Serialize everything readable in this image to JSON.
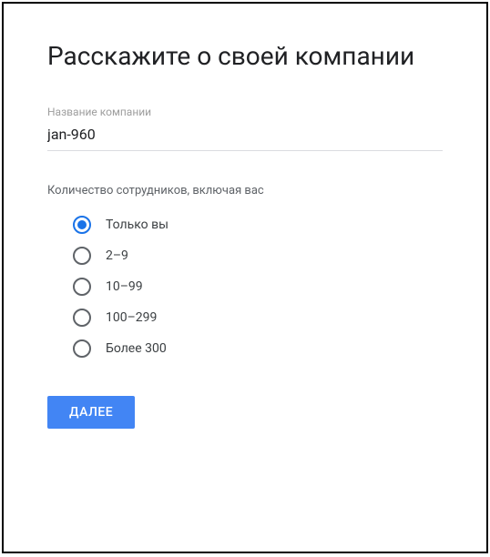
{
  "heading": "Расскажите о своей компании",
  "company_name": {
    "label": "Название компании",
    "value": "jan-960"
  },
  "employees": {
    "label": "Количество сотрудников, включая вас",
    "options": [
      {
        "label": "Только вы",
        "selected": true
      },
      {
        "label": "2–9",
        "selected": false
      },
      {
        "label": "10–99",
        "selected": false
      },
      {
        "label": "100–299",
        "selected": false
      },
      {
        "label": "Более 300",
        "selected": false
      }
    ]
  },
  "next_button": "ДАЛЕЕ"
}
